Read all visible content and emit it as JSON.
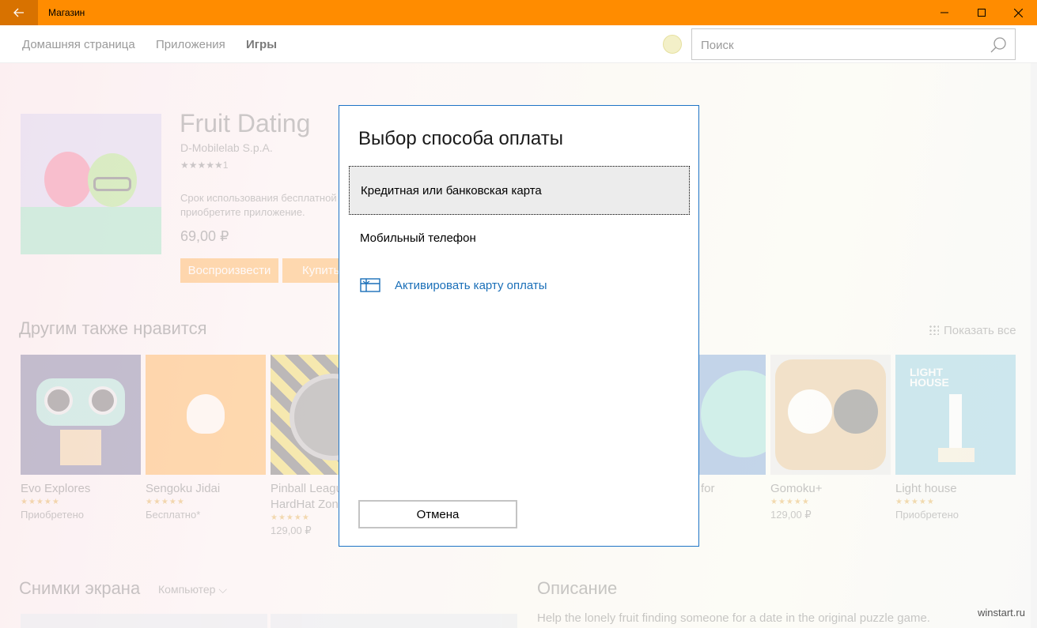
{
  "window": {
    "title": "Магазин"
  },
  "nav": {
    "items": [
      "Домашняя страница",
      "Приложения",
      "Игры"
    ],
    "active": "Игры"
  },
  "search": {
    "placeholder": "Поиск"
  },
  "app": {
    "title": "Fruit Dating",
    "publisher": "D-Mobilelab S.p.A.",
    "rating_stars": "★★★★★",
    "rating_count": "1",
    "desc_line1": "Срок использования бесплатной",
    "desc_line2": "приобретите приложение.",
    "price": "69,00 ₽",
    "play_label": "Воспроизвести",
    "buy_label": "Купить"
  },
  "also_like": {
    "title": "Другим также нравится",
    "show_all": "Показать все",
    "items": [
      {
        "name": "Evo Explores",
        "stars": "★★★★★",
        "status": "Приобретено"
      },
      {
        "name": "Sengoku Jidai",
        "stars": "★★★★★",
        "status": "Бесплатно*"
      },
      {
        "name": "Pinball League",
        "name2": "HardHat Zone",
        "stars": "★★★★★",
        "status": "129,00 ₽"
      },
      {
        "name": "for",
        "stars": "",
        "status": ""
      },
      {
        "name": "Gomoku+",
        "stars": "★★★★★",
        "status": "129,00 ₽"
      },
      {
        "name": "Light house",
        "stars": "★★★★★",
        "status": "Приобретено",
        "logo_text": "LIGHT HOUSE"
      }
    ]
  },
  "screenshots": {
    "title": "Снимки экрана",
    "filter": "Компьютер"
  },
  "description": {
    "title": "Описание",
    "text": "Help the lonely fruit finding someone for a date in the original puzzle game."
  },
  "dialog": {
    "title": "Выбор способа оплаты",
    "options": [
      {
        "label": "Кредитная или банковская карта",
        "selected": true
      },
      {
        "label": "Мобильный телефон",
        "selected": false
      },
      {
        "label": "Активировать карту оплаты",
        "selected": false,
        "icon": "gift-card-icon"
      }
    ],
    "cancel_label": "Отмена"
  },
  "watermark": "winstart.ru",
  "colors": {
    "accent": "#ff8c00",
    "link": "#1a6fb8",
    "dialog_border": "#1e74c6"
  }
}
